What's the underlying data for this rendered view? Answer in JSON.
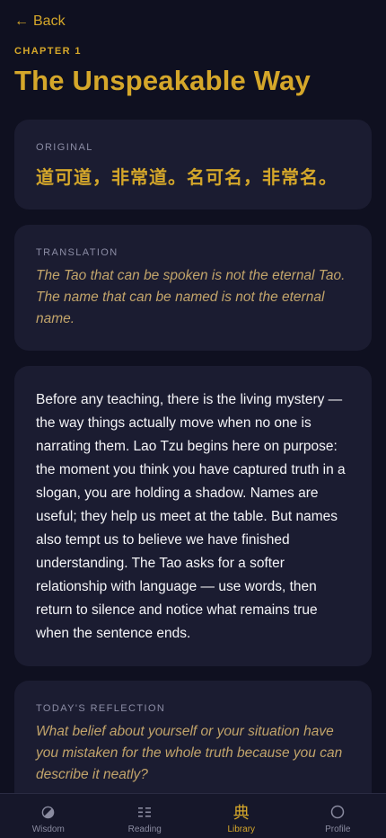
{
  "header": {
    "back_label": "Back",
    "chapter_label": "CHAPTER 1",
    "title": "The Unspeakable Way"
  },
  "original": {
    "label": "ORIGINAL",
    "text": "道可道，非常道。名可名，非常名。"
  },
  "translation": {
    "label": "TRANSLATION",
    "text": "The Tao that can be spoken is not the eternal Tao. The name that can be named is not the eternal name."
  },
  "commentary": {
    "text": "Before any teaching, there is the living mystery — the way things actually move when no one is narrating them. Lao Tzu begins here on purpose: the moment you think you have captured truth in a slogan, you are holding a shadow. Names are useful; they help us meet at the table. But names also tempt us to believe we have finished understanding. The Tao asks for a softer relationship with language — use words, then return to silence and notice what remains true when the sentence ends."
  },
  "reflection": {
    "label": "TODAY'S REFLECTION",
    "text": "What belief about yourself or your situation have you mistaken for the whole truth because you can describe it neatly?"
  },
  "tabs": [
    {
      "label": "Wisdom",
      "icon": "half-circle-icon",
      "active": false
    },
    {
      "label": "Reading",
      "icon": "list-grid-icon",
      "active": false
    },
    {
      "label": "Library",
      "icon": "library-glyph-icon",
      "glyph": "典",
      "active": true
    },
    {
      "label": "Profile",
      "icon": "circle-icon",
      "active": false
    }
  ],
  "colors": {
    "accent": "#d5a72a",
    "background": "#0f1020",
    "card": "#1b1c31",
    "muted": "#8c8da5"
  }
}
